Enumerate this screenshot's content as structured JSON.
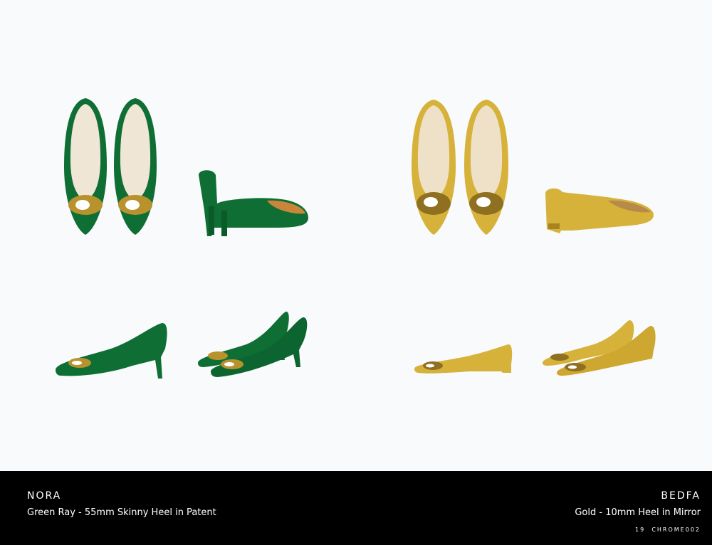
{
  "colors": {
    "background": "#f8fafb",
    "green": "#0f6e34",
    "gold": "#d6b23a",
    "footer": "#000000"
  },
  "products": {
    "left": {
      "name": "NORA",
      "description": "Green Ray - 55mm Skinny Heel in Patent"
    },
    "right": {
      "name": "BEDFA",
      "description": "Gold - 10mm Heel in Mirror"
    }
  },
  "page": {
    "number": "19",
    "code": "CHROME002"
  }
}
